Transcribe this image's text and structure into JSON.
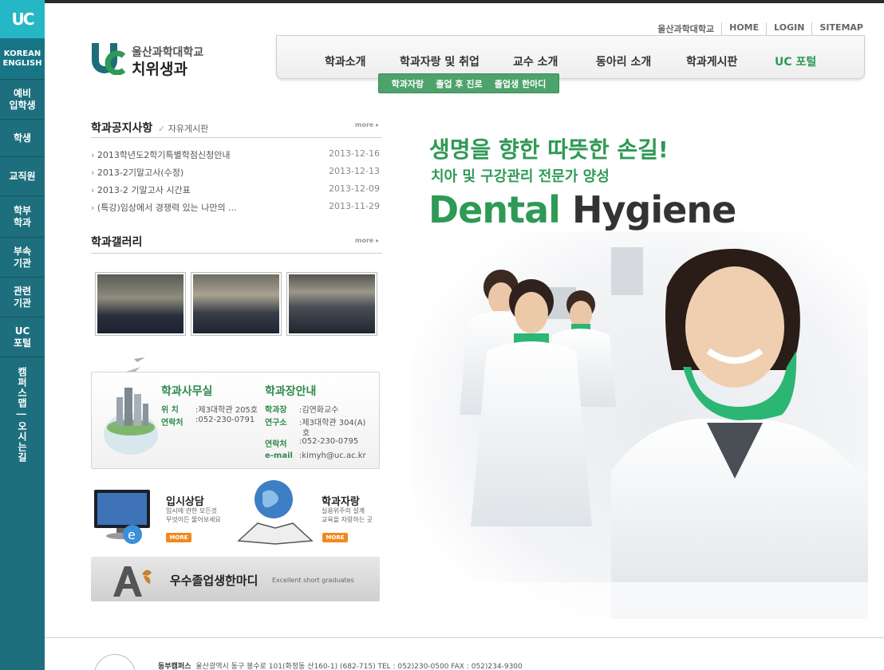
{
  "sidebar": {
    "logo": "UC",
    "lang": "KOREAN\nENGLISH",
    "items": [
      "예비\n입학생",
      "학생",
      "교직원",
      "학부\n학과",
      "부속\n기관",
      "관련\n기관",
      "UC\n포털"
    ],
    "vertical": "캠퍼스맵 | 오시는길"
  },
  "header": {
    "logo_mark": "uc",
    "logo_sub": "울산과학대학교",
    "logo_main": "치위생과",
    "util": [
      "울산과학대학교",
      "HOME",
      "LOGIN",
      "SITEMAP"
    ],
    "nav": [
      "학과소개",
      "학과자랑 및 취업",
      "교수 소개",
      "동아리 소개",
      "학과게시판",
      "UC 포털"
    ],
    "subnav": [
      "학과자랑",
      "졸업 후 진로",
      "졸업생 한마디"
    ]
  },
  "notice": {
    "title": "학과공지사항",
    "tab": "자유게시판",
    "more": "more",
    "items": [
      {
        "title": "2013학년도2학기특별학점신청안내",
        "date": "2013-12-16"
      },
      {
        "title": "2013-2기말고사(수정)",
        "date": "2013-12-13"
      },
      {
        "title": "2013-2 기말고사 시간표",
        "date": "2013-12-09"
      },
      {
        "title": "(특강)임상에서 경쟁력 있는 나만의 ...",
        "date": "2013-11-29"
      }
    ]
  },
  "gallery": {
    "title": "학과갤러리",
    "more": "more"
  },
  "office": {
    "head1": "학과사무실",
    "head2": "학과장안내",
    "loc_label": "위 치",
    "loc_value": ":제3대학관 205호",
    "tel_label": "연락처",
    "tel_value": ":052-230-0791",
    "chair_label": "학과장",
    "chair_value": ":김연화교수",
    "lab_label": "연구소",
    "lab_value": ":제3대학관 304(A)",
    "lab_value2": "호",
    "ctel_label": "연락처",
    "ctel_value": ":052-230-0795",
    "email_label": "e-mail",
    "email_value": ":kimyh@uc.ac.kr"
  },
  "promo1": {
    "title": "입시상담",
    "desc": "입시에 관한 모든것\n무엇이든 물어보세요",
    "more": "MORE"
  },
  "promo2": {
    "title": "학과자랑",
    "desc": "실용위주의 설계\n교육을 자랑하는 곳",
    "more": "MORE"
  },
  "banner": {
    "title": "우수졸업생한마디",
    "sub": "Excellent short graduates"
  },
  "hero": {
    "line1": "생명을 향한 따뜻한 손길!",
    "line2a": "치아 및 구강관리 ",
    "line2b": "전문가 양성",
    "line3a": "Dental ",
    "line3b": "Hygiene"
  },
  "footer": {
    "campus": "동부캠퍼스",
    "address": "울산광역시 동구 봉수로 101(화정동 산160-1) (682-715) TEL : 052)230-0500  FAX : 052)234-9300"
  },
  "colors": {
    "sidebar": "#1e6f7d",
    "sidebar_logo": "#26b7c6",
    "green": "#2e9a55",
    "subnav": "#4da36b",
    "more_btn": "#f08a1e"
  }
}
